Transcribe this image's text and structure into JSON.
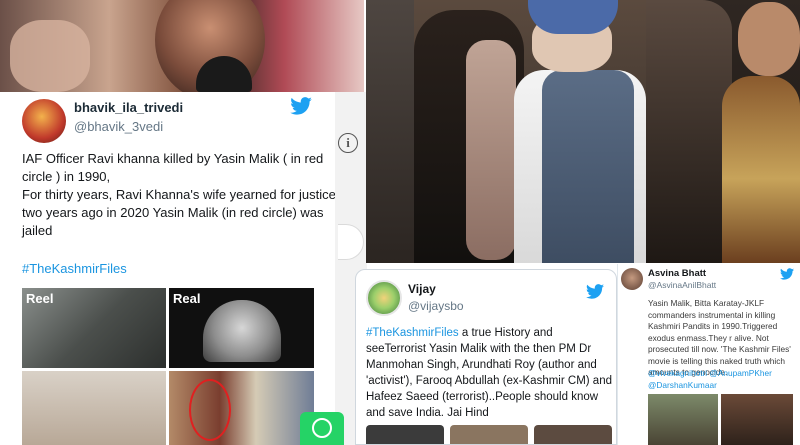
{
  "tweet_1": {
    "name": "bhavik_ila_trivedi",
    "handle": "@bhavik_3vedi",
    "body": "IAF Officer Ravi khanna killed by Yasin Malik ( in red circle ) in 1990,\nFor thirty years, Ravi Khanna's wife yearned for justice, two years ago in 2020 Yasin Malik (in red circle) was jailed",
    "hashtag": "#TheKashmirFiles",
    "media_labels": {
      "reel": "Reel",
      "real": "Real"
    }
  },
  "side": {
    "info_glyph": "i"
  },
  "tweet_2": {
    "name": "Vijay",
    "handle": "@vijaysbo",
    "hashtag": "#TheKashmirFiles",
    "body": " a true History and seeTerrorist Yasin Malik with the then PM Dr Manmohan Singh, Arundhati Roy (author and 'activist'), Farooq Abdullah (ex-Kashmir CM) and Hafeez Saeed (terrorist)..People should know and save India. Jai Hind"
  },
  "tweet_3": {
    "name": "Asvina Bhatt",
    "handle": "@AsvinaAnilBhatt",
    "body": "Yasin Malik, Bitta Karatay-JKLF commanders instrumental in killing Kashmiri Pandits in 1990.Triggered exodus enmass.They r alive. Not prosecuted till now. 'The Kashmir Files' movie is telling this naked truth which amounts to genocide.",
    "mentions": "@vivekagnihotri @AnupamPKher @DarshanKumaar"
  },
  "colors": {
    "twitter_blue": "#1da1f2",
    "hashtag_blue": "#1b95e0",
    "whatsapp_green": "#25d366",
    "red_circle": "#e02020"
  },
  "icons": [
    "twitter-bird-icon",
    "info-icon",
    "whatsapp-icon"
  ]
}
